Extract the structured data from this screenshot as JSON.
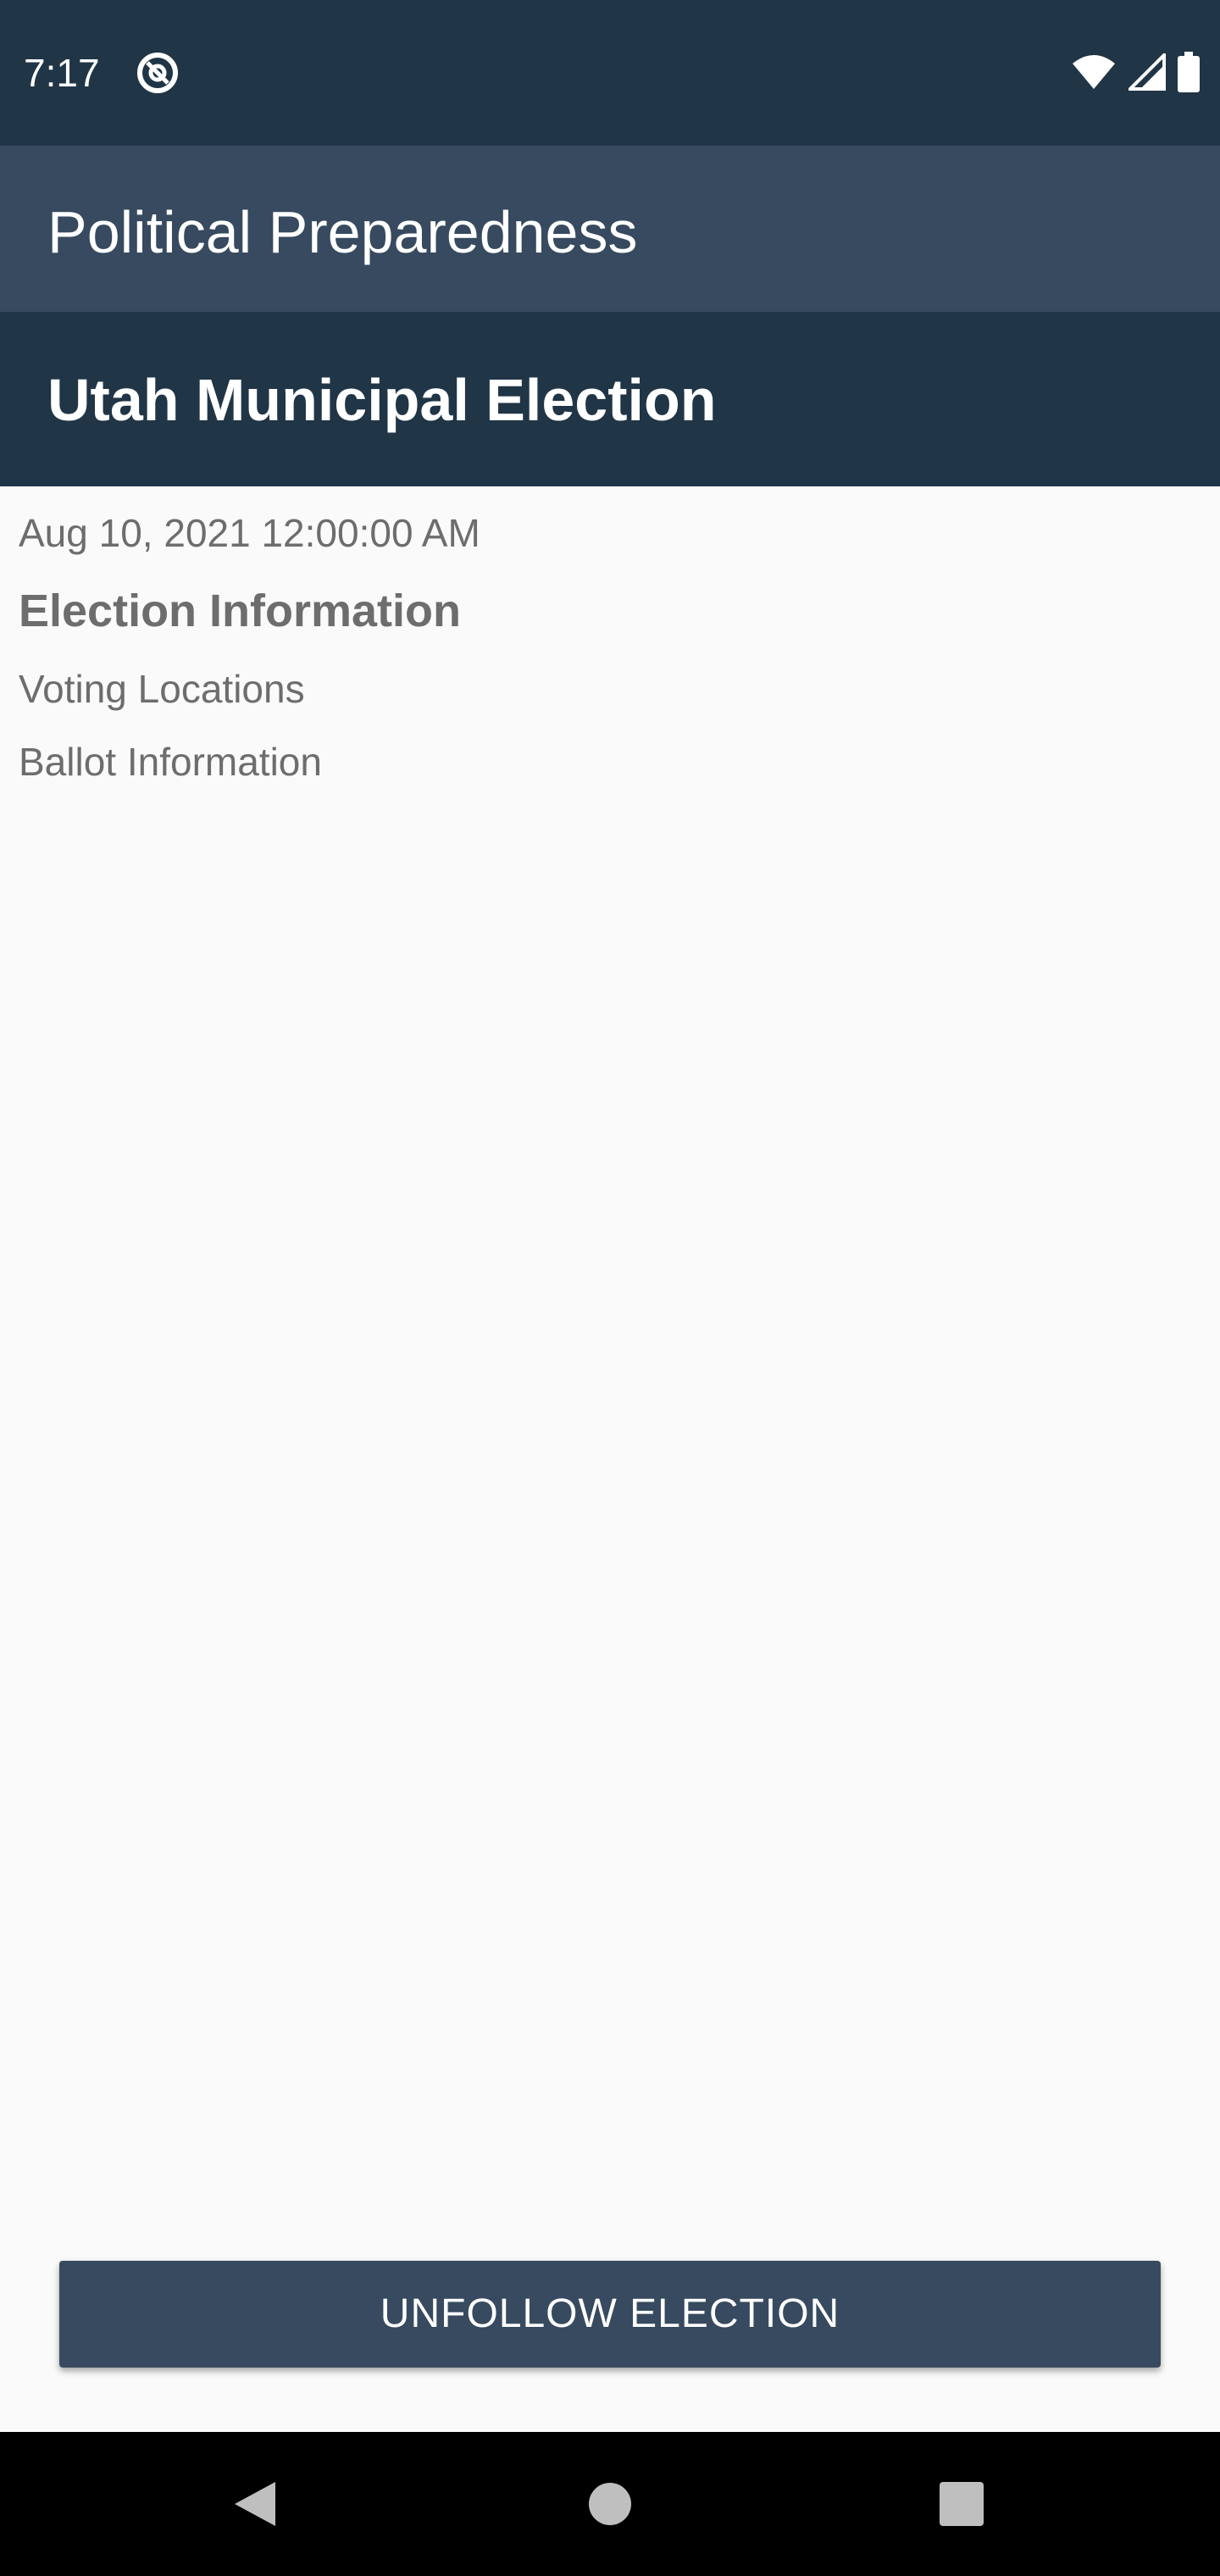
{
  "status_bar": {
    "time": "7:17",
    "app_icon": "at-sign-icon",
    "icons": [
      "wifi-icon",
      "cell-signal-icon",
      "battery-icon"
    ]
  },
  "app_bar": {
    "title": "Political Preparedness"
  },
  "election": {
    "name": "Utah Municipal Election",
    "date": "Aug 10, 2021 12:00:00 AM",
    "info_heading": "Election Information",
    "voting_locations": "Voting Locations",
    "ballot_information": "Ballot Information"
  },
  "actions": {
    "unfollow_label": "UNFOLLOW ELECTION"
  },
  "nav_bar": {
    "buttons": [
      "back-icon",
      "home-icon",
      "recents-icon"
    ]
  },
  "colors": {
    "status_bar_bg": "#203546",
    "app_bar_bg": "#374a5f",
    "header_bg": "#203546",
    "button_bg": "#374a5f",
    "content_bg": "#fafafa",
    "text_gray": "#6d6d6d"
  }
}
